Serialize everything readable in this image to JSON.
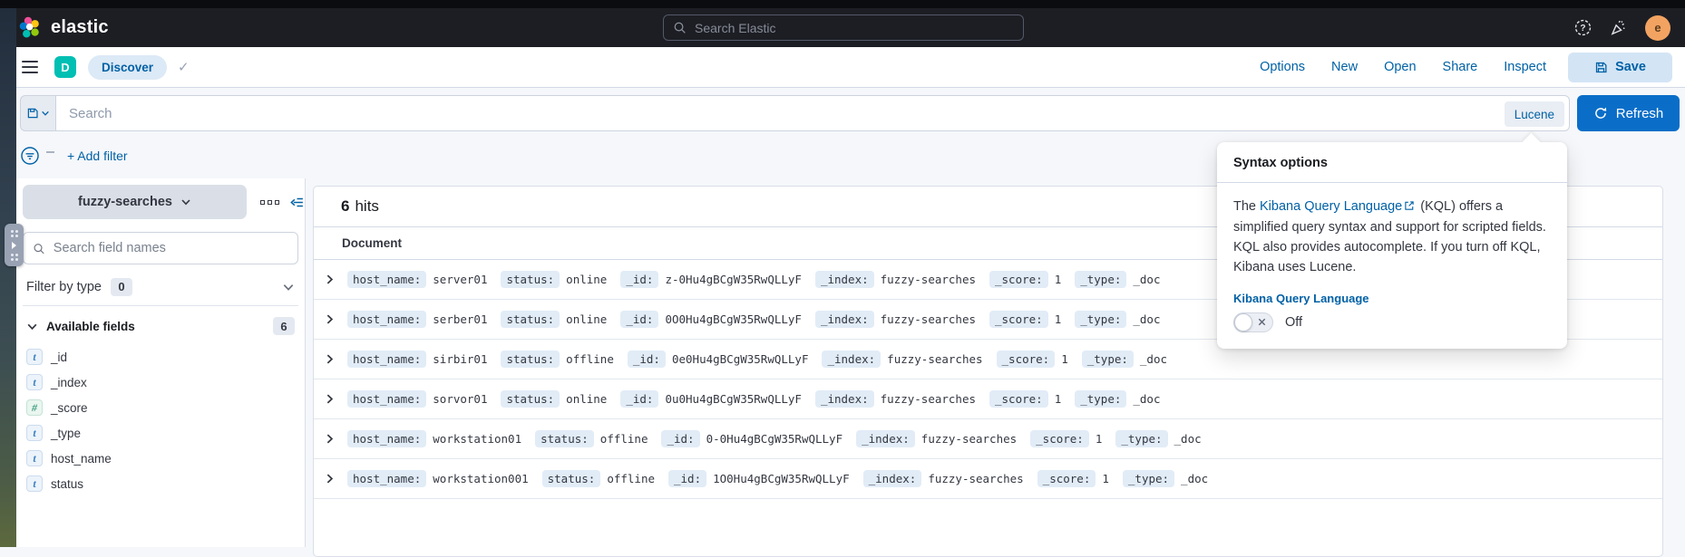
{
  "header": {
    "brand": "elastic",
    "search_placeholder": "Search Elastic",
    "avatar_initial": "e"
  },
  "navbar": {
    "app_initial": "D",
    "breadcrumb": "Discover",
    "links": [
      "Options",
      "New",
      "Open",
      "Share",
      "Inspect"
    ],
    "save_label": "Save"
  },
  "query_bar": {
    "placeholder": "Search",
    "language_label": "Lucene",
    "refresh_label": "Refresh",
    "add_filter_label": "+ Add filter"
  },
  "sidebar": {
    "index_pattern": "fuzzy-searches",
    "field_search_placeholder": "Search field names",
    "filter_by_type_label": "Filter by type",
    "filter_by_type_count": "0",
    "available_fields_label": "Available fields",
    "available_fields_count": "6",
    "fields": [
      {
        "icon": "t",
        "name": "_id"
      },
      {
        "icon": "t",
        "name": "_index"
      },
      {
        "icon": "#",
        "name": "_score"
      },
      {
        "icon": "t",
        "name": "_type"
      },
      {
        "icon": "t",
        "name": "host_name"
      },
      {
        "icon": "t",
        "name": "status"
      }
    ]
  },
  "results": {
    "hits_count": "6",
    "hits_label": "hits",
    "column_header": "Document",
    "rows": [
      {
        "fields": [
          [
            "host_name:",
            "server01"
          ],
          [
            "status:",
            "online"
          ],
          [
            "_id:",
            "z-0Hu4gBCgW35RwQLLyF"
          ],
          [
            "_index:",
            "fuzzy-searches"
          ],
          [
            "_score:",
            "1"
          ],
          [
            "_type:",
            "_doc"
          ]
        ]
      },
      {
        "fields": [
          [
            "host_name:",
            "serber01"
          ],
          [
            "status:",
            "online"
          ],
          [
            "_id:",
            "0O0Hu4gBCgW35RwQLLyF"
          ],
          [
            "_index:",
            "fuzzy-searches"
          ],
          [
            "_score:",
            "1"
          ],
          [
            "_type:",
            "_doc"
          ]
        ]
      },
      {
        "fields": [
          [
            "host_name:",
            "sirbir01"
          ],
          [
            "status:",
            "offline"
          ],
          [
            "_id:",
            "0e0Hu4gBCgW35RwQLLyF"
          ],
          [
            "_index:",
            "fuzzy-searches"
          ],
          [
            "_score:",
            "1"
          ],
          [
            "_type:",
            "_doc"
          ]
        ]
      },
      {
        "fields": [
          [
            "host_name:",
            "sorvor01"
          ],
          [
            "status:",
            "online"
          ],
          [
            "_id:",
            "0u0Hu4gBCgW35RwQLLyF"
          ],
          [
            "_index:",
            "fuzzy-searches"
          ],
          [
            "_score:",
            "1"
          ],
          [
            "_type:",
            "_doc"
          ]
        ]
      },
      {
        "fields": [
          [
            "host_name:",
            "workstation01"
          ],
          [
            "status:",
            "offline"
          ],
          [
            "_id:",
            "0-0Hu4gBCgW35RwQLLyF"
          ],
          [
            "_index:",
            "fuzzy-searches"
          ],
          [
            "_score:",
            "1"
          ],
          [
            "_type:",
            "_doc"
          ]
        ]
      },
      {
        "fields": [
          [
            "host_name:",
            "workstation001"
          ],
          [
            "status:",
            "offline"
          ],
          [
            "_id:",
            "1O0Hu4gBCgW35RwQLLyF"
          ],
          [
            "_index:",
            "fuzzy-searches"
          ],
          [
            "_score:",
            "1"
          ],
          [
            "_type:",
            "_doc"
          ]
        ]
      }
    ]
  },
  "popup": {
    "title": "Syntax options",
    "body_pre": "The ",
    "link_text": "Kibana Query Language",
    "body_post": " (KQL) offers a simplified query syntax and support for scripted fields. KQL also provides autocomplete. If you turn off KQL, Kibana uses Lucene.",
    "toggle_label": "Kibana Query Language",
    "toggle_state": "Off"
  },
  "colors": {
    "header_bg": "#1d1e24",
    "link_blue": "#0061a6",
    "teal": "#00bfb3",
    "refresh_blue": "#0a6ec8",
    "save_bg": "#d3e5f5",
    "badge_bg": "#e1ecf7",
    "border": "#d3dae6",
    "page_bg": "#f5f7fa",
    "avatar_bg": "#f3a361"
  }
}
